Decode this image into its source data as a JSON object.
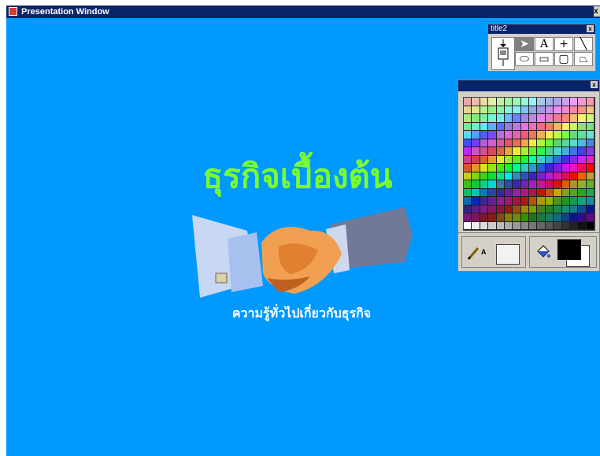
{
  "window": {
    "title": "Presentation Window",
    "close_label": "x"
  },
  "slide": {
    "title": "ธุรกิจเบื้องต้น",
    "subtitle": "ความรู้ทั่วไปเกี่ยวกับธุรกิจ",
    "background_color": "#0099ff",
    "title_color": "#7cff2a"
  },
  "tool_palette": {
    "title": "title2",
    "close_label": "x",
    "tools": [
      {
        "name": "pointer-tool-button",
        "glyph": "➤",
        "selected": true
      },
      {
        "name": "text-tool-button",
        "glyph": "A",
        "selected": false
      },
      {
        "name": "crosshair-tool-button",
        "glyph": "+",
        "selected": false
      },
      {
        "name": "line-tool-button",
        "glyph": "╲",
        "selected": false
      },
      {
        "name": "ellipse-tool-button",
        "glyph": "⬭",
        "selected": false
      },
      {
        "name": "rectangle-tool-button",
        "glyph": "▭",
        "selected": false
      },
      {
        "name": "rounded-rectangle-tool-button",
        "glyph": "▢",
        "selected": false
      },
      {
        "name": "polygon-tool-button",
        "glyph": "⏢",
        "selected": false
      }
    ]
  },
  "color_palette": {
    "close_label": "x",
    "text_sample": "A",
    "foreground_color": "#000000",
    "background_color": "#ffffff"
  }
}
